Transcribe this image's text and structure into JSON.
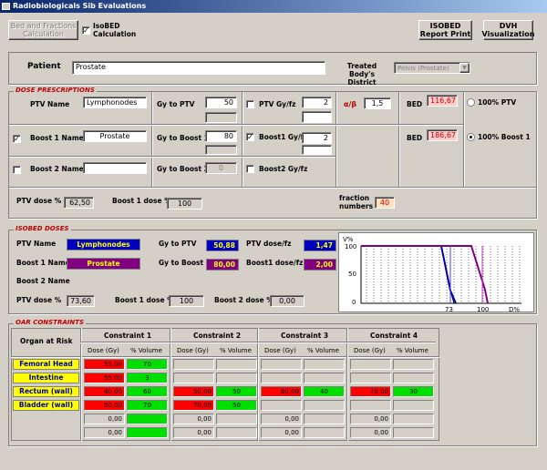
{
  "window": {
    "title": "Radiobiologicals Sib Evaluations"
  },
  "toolbar": {
    "bed_fractions_label": "Bed and Fractions Calculation",
    "isobed_calc_label": "IsoBED Calculation",
    "isobed_checked": true,
    "isobed_report_label": "ISOBED Report Print",
    "dvh_label": "DVH Visualization"
  },
  "patient": {
    "label": "Patient",
    "value": "Prostate",
    "district_label": "Treated Body's District",
    "district_value": "Pelvis (Prostate)"
  },
  "dose_prescriptions": {
    "title": "DOSE PRESCRIPTIONS",
    "ptv_name_label": "PTV Name",
    "ptv_name_value": "Lymphonodes",
    "gy_to_ptv_label": "Gy to PTV",
    "gy_to_ptv_value": "50",
    "ptv_gyfz_label": "PTV Gy/fz",
    "ptv_gyfz_value": "2",
    "alpha_beta_label": "α/β",
    "alpha_beta_value": "1,5",
    "boost1_name_label": "Boost 1 Name",
    "boost1_name_value": "Prostate",
    "boost1_checked": true,
    "gy_to_boost1_label": "Gy to Boost 1",
    "gy_to_boost1_value": "80",
    "boost1_gyfz_label": "Boost1 Gy/fz",
    "boost1_gyfz_value": "2",
    "boost1_gyfz_checked": true,
    "boost2_name_label": "Boost 2 Name",
    "boost2_name_value": "",
    "gy_to_boost2_label": "Gy to Boost 2",
    "gy_to_boost2_value": "0",
    "boost2_gyfz_label": "Boost2 Gy/fz",
    "bed_label": "BED",
    "bed_ptv_value": "116,67",
    "bed_boost1_value": "186,67",
    "radio_ptv_label": "100% PTV",
    "radio_boost1_label": "100% Boost 1",
    "ptv_dose_pct_label": "PTV dose %",
    "ptv_dose_pct_value": "62,50",
    "boost1_dose_pct_label": "Boost 1 dose %",
    "boost1_dose_pct_value": "100",
    "fraction_numbers_label": "fraction numbers",
    "fraction_numbers_value": "40"
  },
  "isobed": {
    "title": "ISOBED DOSES",
    "ptv_name_label": "PTV Name",
    "ptv_name_value": "Lymphonodes",
    "gy_to_ptv_label": "Gy to PTV",
    "gy_to_ptv_value": "50,88",
    "ptv_dosefz_label": "PTV dose/fz",
    "ptv_dosefz_value": "1,47",
    "boost1_name_label": "Boost 1 Name",
    "boost1_name_value": "Prostate",
    "gy_to_boost1_label": "Gy to Boost 1",
    "gy_to_boost1_value": "80,00",
    "boost1_dosefz_label": "Boost1 dose/fz",
    "boost1_dosefz_value": "2,00",
    "boost2_name_label": "Boost 2 Name",
    "ptv_dose_pct_label": "PTV dose %",
    "ptv_dose_pct_value": "73,60",
    "boost1_dose_pct_label": "Boost 1 dose %",
    "boost1_dose_pct_value": "100",
    "boost2_dose_pct_label": "Boost 2 dose %",
    "boost2_dose_pct_value": "0,00",
    "chart": {
      "ylabel": "V%",
      "xlabel": "D%",
      "yticks": [
        "100",
        "50",
        "0"
      ],
      "xticks": [
        "73",
        "100"
      ],
      "colors": {
        "ptv": "#0000a0",
        "boost": "#a000a0"
      }
    }
  },
  "oar": {
    "title": "OAR CONSTRAINTS",
    "organ_header": "Organ at Risk",
    "constraint_headers": [
      "Constraint 1",
      "Constraint 2",
      "Constraint 3",
      "Constraint 4"
    ],
    "dose_header": "Dose (Gy)",
    "volume_header": "% Volume",
    "rows": [
      {
        "organ": "Femoral Head",
        "cells": [
          [
            "55,00",
            "70"
          ],
          [
            "",
            ""
          ],
          [
            "",
            ""
          ],
          [
            "",
            ""
          ]
        ]
      },
      {
        "organ": "Intestine",
        "cells": [
          [
            "55,00",
            "3"
          ],
          [
            "",
            ""
          ],
          [
            "",
            ""
          ],
          [
            "",
            ""
          ]
        ]
      },
      {
        "organ": "Rectum (wall)",
        "cells": [
          [
            "40,00",
            "60"
          ],
          [
            "50,00",
            "50"
          ],
          [
            "60,00",
            "40"
          ],
          [
            "70,00",
            "30"
          ]
        ]
      },
      {
        "organ": "Bladder (wall)",
        "cells": [
          [
            "50,00",
            "70"
          ],
          [
            "70,00",
            "50"
          ],
          [
            "",
            ""
          ],
          [
            "",
            ""
          ]
        ]
      },
      {
        "organ": "",
        "cells": [
          [
            "0,00",
            ""
          ],
          [
            "0,00",
            ""
          ],
          [
            "0,00",
            ""
          ],
          [
            "0,00",
            ""
          ]
        ]
      },
      {
        "organ": "",
        "cells": [
          [
            "0,00",
            ""
          ],
          [
            "0,00",
            ""
          ],
          [
            "0,00",
            ""
          ],
          [
            "0,00",
            ""
          ]
        ]
      }
    ],
    "cell_colors": [
      [
        [
          "red",
          "green"
        ],
        [
          "gray",
          "gray"
        ],
        [
          "gray",
          "gray"
        ],
        [
          "gray",
          "gray"
        ]
      ],
      [
        [
          "red",
          "green"
        ],
        [
          "gray",
          "gray"
        ],
        [
          "gray",
          "gray"
        ],
        [
          "gray",
          "gray"
        ]
      ],
      [
        [
          "red",
          "green"
        ],
        [
          "red",
          "green"
        ],
        [
          "red",
          "green"
        ],
        [
          "red",
          "green"
        ]
      ],
      [
        [
          "red",
          "green"
        ],
        [
          "red",
          "green"
        ],
        [
          "gray",
          "gray"
        ],
        [
          "gray",
          "gray"
        ]
      ],
      [
        [
          "gray",
          "green"
        ],
        [
          "gray",
          "gray"
        ],
        [
          "gray",
          "gray"
        ],
        [
          "gray",
          "gray"
        ]
      ],
      [
        [
          "gray",
          "green"
        ],
        [
          "gray",
          "gray"
        ],
        [
          "gray",
          "gray"
        ],
        [
          "gray",
          "gray"
        ]
      ]
    ]
  }
}
